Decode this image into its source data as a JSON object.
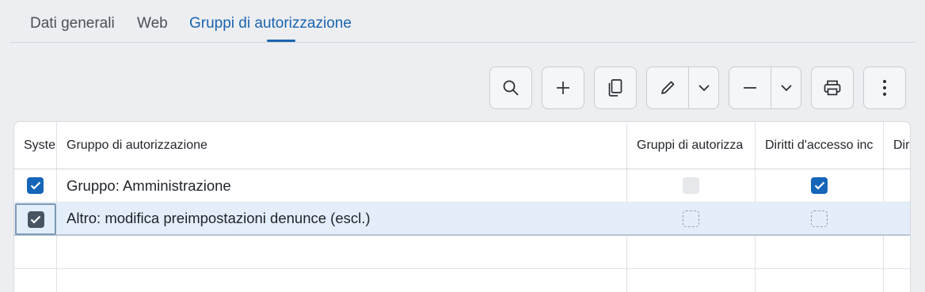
{
  "tabs": [
    {
      "label": "Dati generali"
    },
    {
      "label": "Web"
    },
    {
      "label": "Gruppi di autorizzazione",
      "active": true
    }
  ],
  "toolbar": {
    "search_icon": "search-icon",
    "add_icon": "plus-icon",
    "copy_icon": "copy-icon",
    "edit_icon": "pencil-icon",
    "remove_icon": "minus-icon",
    "print_icon": "printer-icon",
    "more_icon": "more-vertical-icon"
  },
  "table": {
    "columns": [
      "Syste",
      "Gruppo di autorizzazione",
      "Gruppi di autorizza",
      "Diritti d'accesso inc",
      "Dir"
    ],
    "rows": [
      {
        "system": true,
        "group": "Gruppo: Amministrazione",
        "groups_auth": false,
        "access_rights": true
      },
      {
        "system": true,
        "group": "Altro: modifica preimpostazioni denunce (escl.)",
        "groups_auth": null,
        "access_rights": null,
        "selected": true
      }
    ]
  },
  "colors": {
    "accent": "#1a64b0",
    "checkbox": "#1565b8",
    "selected_row": "#e4eefb"
  }
}
